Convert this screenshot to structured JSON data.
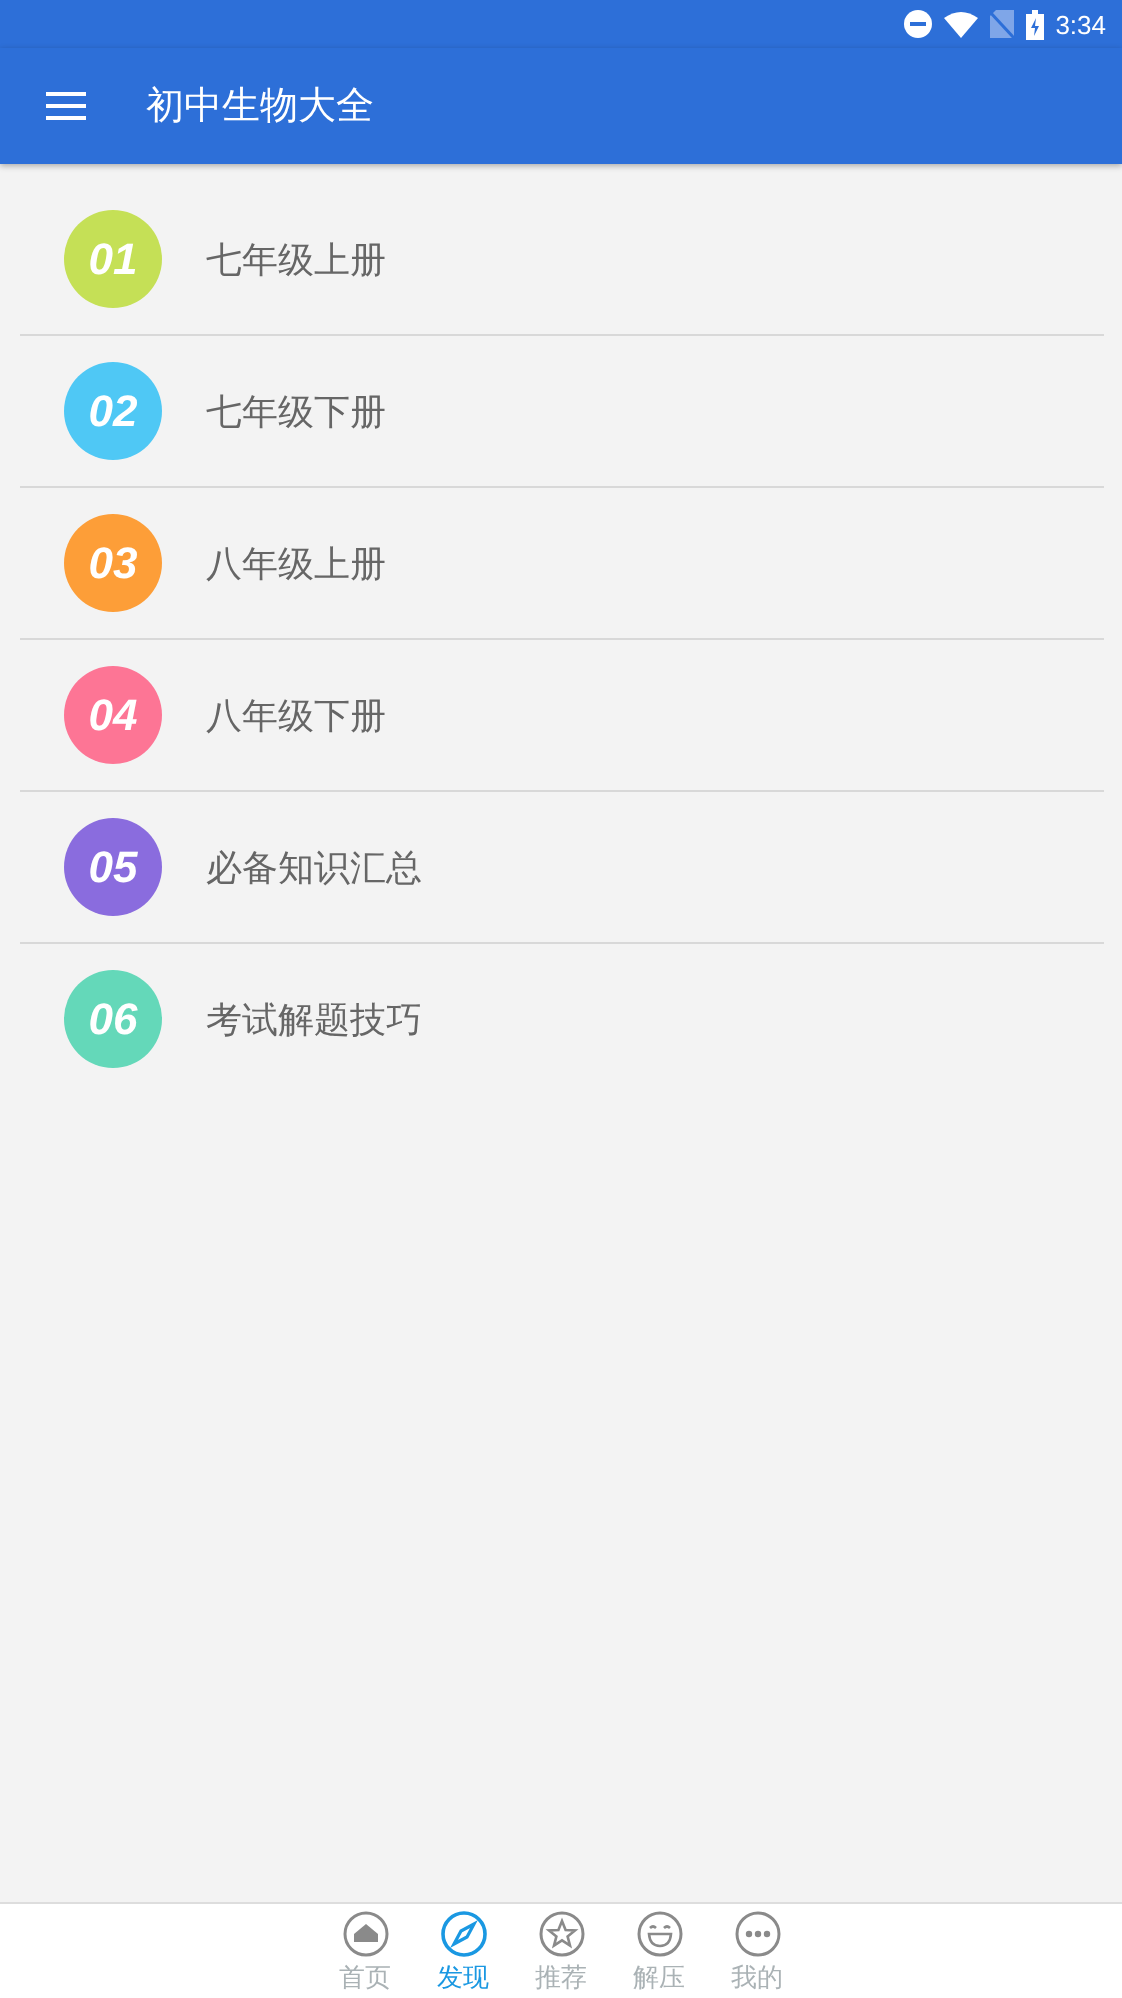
{
  "status_bar": {
    "time": "3:34"
  },
  "app_bar": {
    "title": "初中生物大全"
  },
  "items": [
    {
      "number": "01",
      "label": "七年级上册",
      "color": "#c5e056"
    },
    {
      "number": "02",
      "label": "七年级下册",
      "color": "#4fc8f5"
    },
    {
      "number": "03",
      "label": "八年级上册",
      "color": "#fd9e38"
    },
    {
      "number": "04",
      "label": "八年级下册",
      "color": "#fd7595"
    },
    {
      "number": "05",
      "label": "必备知识汇总",
      "color": "#8a6cde"
    },
    {
      "number": "06",
      "label": "考试解题技巧",
      "color": "#64d8b9"
    }
  ],
  "bottom_nav": [
    {
      "kind": "home",
      "label": "首页",
      "selected": false
    },
    {
      "kind": "compass",
      "label": "发现",
      "selected": true
    },
    {
      "kind": "star",
      "label": "推荐",
      "selected": false
    },
    {
      "kind": "smile",
      "label": "解压",
      "selected": false
    },
    {
      "kind": "more",
      "label": "我的",
      "selected": false
    }
  ]
}
